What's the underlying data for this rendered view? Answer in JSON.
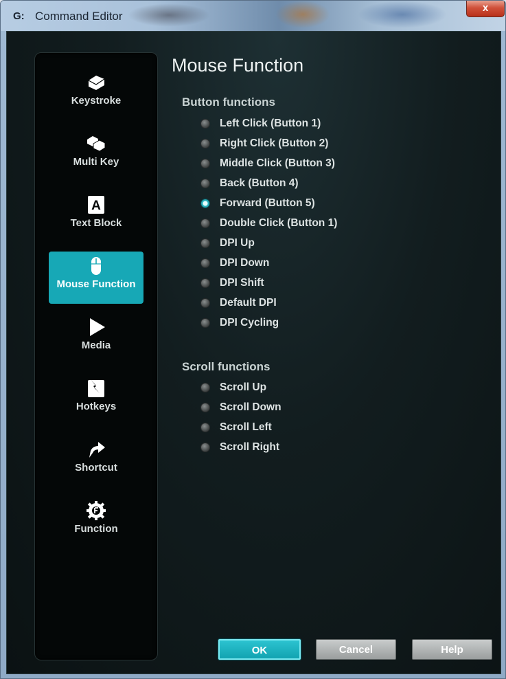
{
  "window": {
    "title": "Command Editor",
    "close_label": "x"
  },
  "sidebar": {
    "items": [
      {
        "label": "Keystroke",
        "icon": "keycap-icon",
        "active": false
      },
      {
        "label": "Multi Key",
        "icon": "multi-keycap-icon",
        "active": false
      },
      {
        "label": "Text Block",
        "icon": "text-block-icon",
        "active": false
      },
      {
        "label": "Mouse Function",
        "icon": "mouse-icon",
        "active": true
      },
      {
        "label": "Media",
        "icon": "play-icon",
        "active": false
      },
      {
        "label": "Hotkeys",
        "icon": "hotkey-icon",
        "active": false
      },
      {
        "label": "Shortcut",
        "icon": "shortcut-arrow-icon",
        "active": false
      },
      {
        "label": "Function",
        "icon": "function-gear-icon",
        "active": false
      }
    ],
    "text_block_glyph": "A"
  },
  "main": {
    "title": "Mouse Function",
    "button_section": {
      "title": "Button functions",
      "options": [
        {
          "label": "Left Click (Button 1)",
          "checked": false
        },
        {
          "label": "Right Click (Button 2)",
          "checked": false
        },
        {
          "label": "Middle Click (Button 3)",
          "checked": false
        },
        {
          "label": "Back (Button 4)",
          "checked": false
        },
        {
          "label": "Forward (Button 5)",
          "checked": true
        },
        {
          "label": "Double Click (Button 1)",
          "checked": false
        },
        {
          "label": "DPI Up",
          "checked": false
        },
        {
          "label": "DPI Down",
          "checked": false
        },
        {
          "label": "DPI Shift",
          "checked": false
        },
        {
          "label": "Default DPI",
          "checked": false
        },
        {
          "label": "DPI Cycling",
          "checked": false
        }
      ]
    },
    "scroll_section": {
      "title": "Scroll functions",
      "options": [
        {
          "label": "Scroll Up",
          "checked": false
        },
        {
          "label": "Scroll Down",
          "checked": false
        },
        {
          "label": "Scroll Left",
          "checked": false
        },
        {
          "label": "Scroll Right",
          "checked": false
        }
      ]
    }
  },
  "footer": {
    "ok_label": "OK",
    "cancel_label": "Cancel",
    "help_label": "Help"
  },
  "colors": {
    "accent": "#17a8b6",
    "background": "#0b1213"
  }
}
